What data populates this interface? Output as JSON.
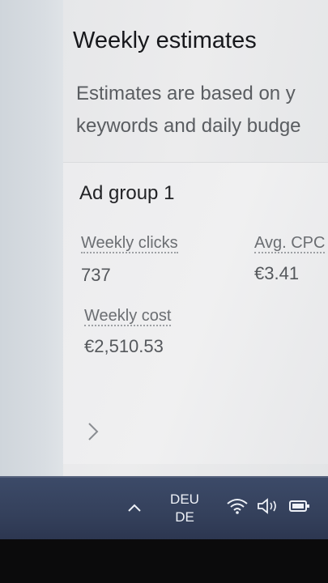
{
  "page": {
    "title": "Weekly estimates",
    "description_line1": "Estimates are based on y",
    "description_line2": "keywords and daily budge"
  },
  "ad_group": {
    "title": "Ad group 1",
    "weekly_clicks_label": "Weekly clicks",
    "weekly_clicks_value": "737",
    "avg_cpc_label": "Avg. CPC",
    "avg_cpc_value": "€3.41",
    "weekly_cost_label": "Weekly cost",
    "weekly_cost_value": "€2,510.53"
  },
  "taskbar": {
    "lang_code": "DEU",
    "lang_region": "DE",
    "icons": [
      "chevron-up-icon",
      "wifi-icon",
      "volume-icon",
      "battery-icon"
    ]
  },
  "colors": {
    "taskbar": "#34405b",
    "title_text": "#17181c",
    "muted_text": "#5a5d61"
  }
}
